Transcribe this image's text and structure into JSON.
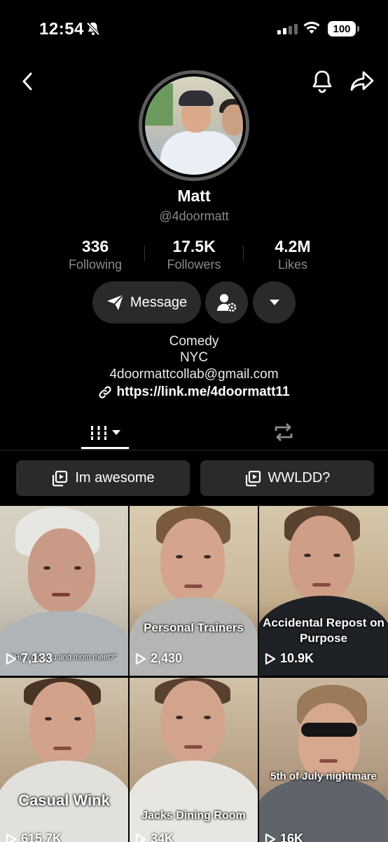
{
  "status_bar": {
    "time": "12:54",
    "battery": "100",
    "icons": [
      "bell-off-icon",
      "signal-icon",
      "wifi-icon",
      "battery-icon"
    ]
  },
  "nav": {
    "icons": [
      "chevron-left-icon",
      "bell-icon",
      "share-icon"
    ]
  },
  "profile": {
    "name": "Matt",
    "handle": "@4doormatt"
  },
  "stats": [
    {
      "value": "336",
      "label": "Following"
    },
    {
      "value": "17.5K",
      "label": "Followers"
    },
    {
      "value": "4.2M",
      "label": "Likes"
    }
  ],
  "actions": {
    "message_label": "Message",
    "icons": [
      "send-icon",
      "user-gear-icon",
      "caret-down-icon"
    ]
  },
  "bio": {
    "line1": "Comedy",
    "line2": "NYC",
    "line3": "4doormattcollab@gmail.com",
    "link": "https://link.me/4doormatt11"
  },
  "tabs": {
    "icons": [
      "grid-icon",
      "repost-icon"
    ]
  },
  "playlists": [
    {
      "label": "Im awesome"
    },
    {
      "label": "WWLDD?"
    }
  ],
  "videos": [
    {
      "caption": "\"How did you and mom meet?\"",
      "views": "7,133"
    },
    {
      "caption": "Personal Trainers",
      "views": "2,430"
    },
    {
      "caption": "Accidental Repost on Purpose",
      "views": "10.9K"
    },
    {
      "caption": "Casual Wink",
      "views": "615.7K"
    },
    {
      "caption": "Jacks Dining Room",
      "views": "34K"
    },
    {
      "caption": "5th of July nightmare",
      "views": "16K"
    }
  ]
}
